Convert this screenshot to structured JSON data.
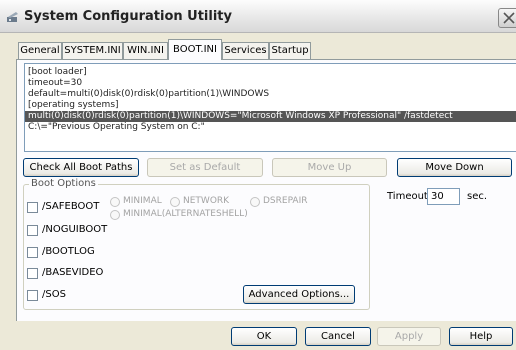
{
  "window": {
    "title": "System Configuration Utility"
  },
  "tabs": [
    {
      "label": "General"
    },
    {
      "label": "SYSTEM.INI"
    },
    {
      "label": "WIN.INI"
    },
    {
      "label": "BOOT.INI",
      "active": true
    },
    {
      "label": "Services"
    },
    {
      "label": "Startup"
    }
  ],
  "boot_ini": {
    "lines": [
      "[boot loader]",
      "timeout=30",
      "default=multi(0)disk(0)rdisk(0)partition(1)\\WINDOWS",
      "[operating systems]",
      "multi(0)disk(0)rdisk(0)partition(1)\\WINDOWS=\"Microsoft Windows XP Professional\" /fastdetect",
      "C:\\=\"Previous Operating System on C:\""
    ],
    "selected_line": 4
  },
  "actions": {
    "check_all": "Check All Boot Paths",
    "set_default": "Set as Default",
    "move_up": "Move Up",
    "move_down": "Move Down"
  },
  "boot_options": {
    "label": "Boot Options",
    "checkboxes": [
      "/SAFEBOOT",
      "/NOGUIBOOT",
      "/BOOTLOG",
      "/BASEVIDEO",
      "/SOS"
    ],
    "radios": [
      "MINIMAL",
      "NETWORK",
      "DSREPAIR",
      "MINIMAL(ALTERNATESHELL)"
    ],
    "advanced": "Advanced Options..."
  },
  "timeout": {
    "label": "Timeout:",
    "value": "30",
    "unit": "sec."
  },
  "footer": {
    "ok": "OK",
    "cancel": "Cancel",
    "apply": "Apply",
    "help": "Help"
  }
}
